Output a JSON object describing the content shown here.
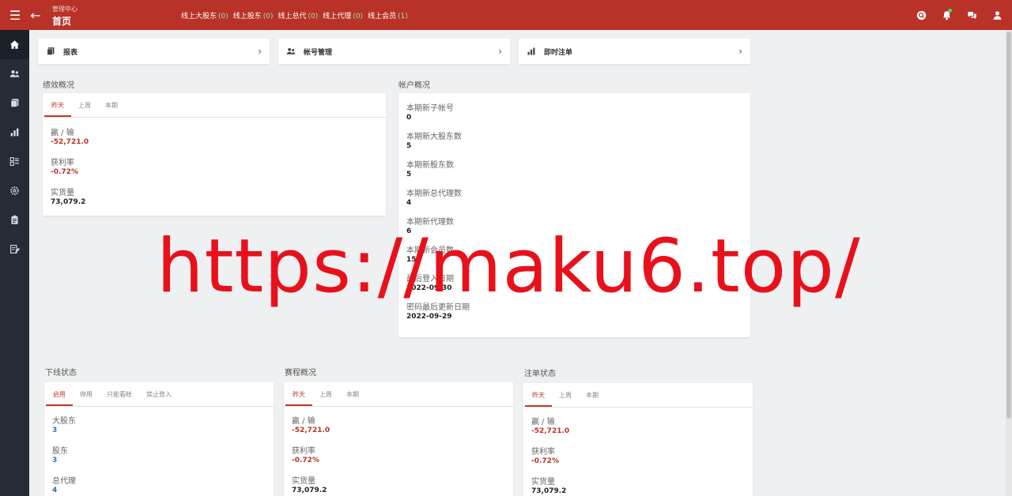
{
  "header": {
    "breadcrumb": "管理中心",
    "title": "首页",
    "online": [
      {
        "label": "线上大股东",
        "count": "(0)"
      },
      {
        "label": "线上股东",
        "count": "(0)"
      },
      {
        "label": "线上总代",
        "count": "(0)"
      },
      {
        "label": "线上代理",
        "count": "(0)"
      },
      {
        "label": "线上会员",
        "count": "(1)"
      }
    ],
    "accent_color": "#b83228"
  },
  "quick_links": [
    {
      "label": "报表"
    },
    {
      "label": "帐号管理"
    },
    {
      "label": "即时注单"
    }
  ],
  "performance": {
    "title": "绩效概况",
    "tabs": [
      "昨天",
      "上周",
      "本期"
    ],
    "stats": [
      {
        "label": "赢 / 输",
        "value": "-52,721.0"
      },
      {
        "label": "获利率",
        "value": "-0.72%"
      },
      {
        "label": "实货量",
        "value": "73,079.2"
      }
    ]
  },
  "account": {
    "title": "帐户概况",
    "stats": [
      {
        "label": "本期新子帐号",
        "value": "0"
      },
      {
        "label": "本期新大股东数",
        "value": "5"
      },
      {
        "label": "本期新股东数",
        "value": "5"
      },
      {
        "label": "本期新总代理数",
        "value": "4"
      },
      {
        "label": "本期新代理数",
        "value": "6"
      },
      {
        "label": "本期新会员数",
        "value": "15"
      },
      {
        "label": "最后登入日期",
        "value": "2022-09-30"
      },
      {
        "label": "密码最后更新日期",
        "value": "2022-09-29"
      }
    ]
  },
  "downline": {
    "title": "下线状态",
    "tabs": [
      "启用",
      "停用",
      "只能看帐",
      "禁止登入"
    ],
    "stats": [
      {
        "label": "大股东",
        "value": "3"
      },
      {
        "label": "股东",
        "value": "3"
      },
      {
        "label": "总代理",
        "value": "4"
      }
    ]
  },
  "events": {
    "title": "赛程概况",
    "tabs": [
      "昨天",
      "上周",
      "本期"
    ],
    "stats": [
      {
        "label": "赢 / 输",
        "value": "-52,721.0"
      },
      {
        "label": "获利率",
        "value": "-0.72%"
      },
      {
        "label": "实货量",
        "value": "73,079.2"
      }
    ]
  },
  "bets": {
    "title": "注单状态",
    "tabs": [
      "昨天",
      "上周",
      "本期"
    ],
    "stats": [
      {
        "label": "赢 / 输",
        "value": "-52,721.0"
      },
      {
        "label": "获利率",
        "value": "-0.72%"
      },
      {
        "label": "实货量",
        "value": "73,079.2"
      }
    ]
  },
  "watermark": "https://maku6.top/"
}
